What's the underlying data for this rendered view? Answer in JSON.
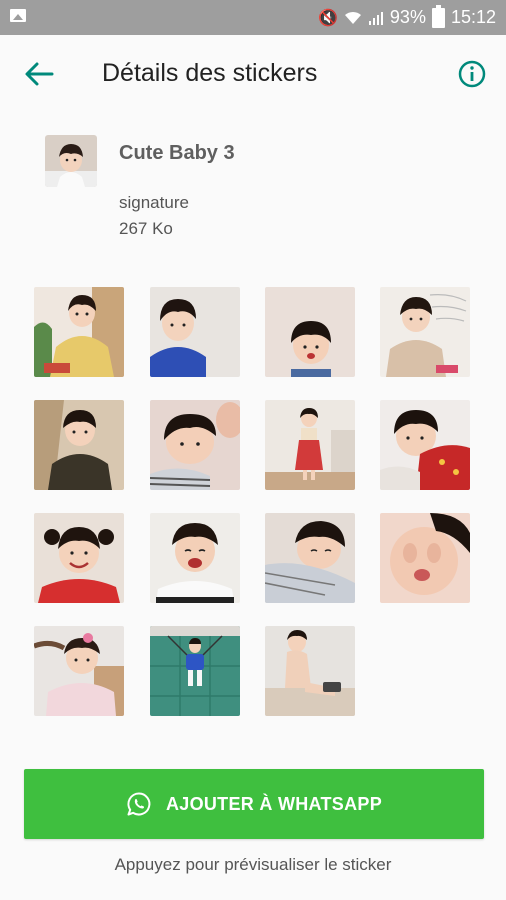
{
  "status_bar": {
    "battery_percent": "93%",
    "time": "15:12",
    "icons": [
      "gallery-icon",
      "mute-icon",
      "wifi-icon",
      "signal-icon",
      "battery-icon"
    ]
  },
  "toolbar": {
    "title": "Détails des stickers",
    "back_icon": "arrow-left-icon",
    "info_icon": "info-icon"
  },
  "pack": {
    "name": "Cute Baby  3",
    "publisher": "signature",
    "size": "267 Ko"
  },
  "stickers": [
    {
      "name": "sticker-1"
    },
    {
      "name": "sticker-2"
    },
    {
      "name": "sticker-3"
    },
    {
      "name": "sticker-4"
    },
    {
      "name": "sticker-5"
    },
    {
      "name": "sticker-6"
    },
    {
      "name": "sticker-7"
    },
    {
      "name": "sticker-8"
    },
    {
      "name": "sticker-9"
    },
    {
      "name": "sticker-10"
    },
    {
      "name": "sticker-11"
    },
    {
      "name": "sticker-12"
    },
    {
      "name": "sticker-13"
    },
    {
      "name": "sticker-14"
    },
    {
      "name": "sticker-15"
    }
  ],
  "add_button": {
    "label": "AJOUTER À WHATSAPP",
    "icon": "whatsapp-icon"
  },
  "hint": "Appuyez pour prévisualiser le sticker",
  "colors": {
    "accent": "#00897b",
    "button": "#3fbf3f",
    "status_bar": "#9e9e9e"
  }
}
